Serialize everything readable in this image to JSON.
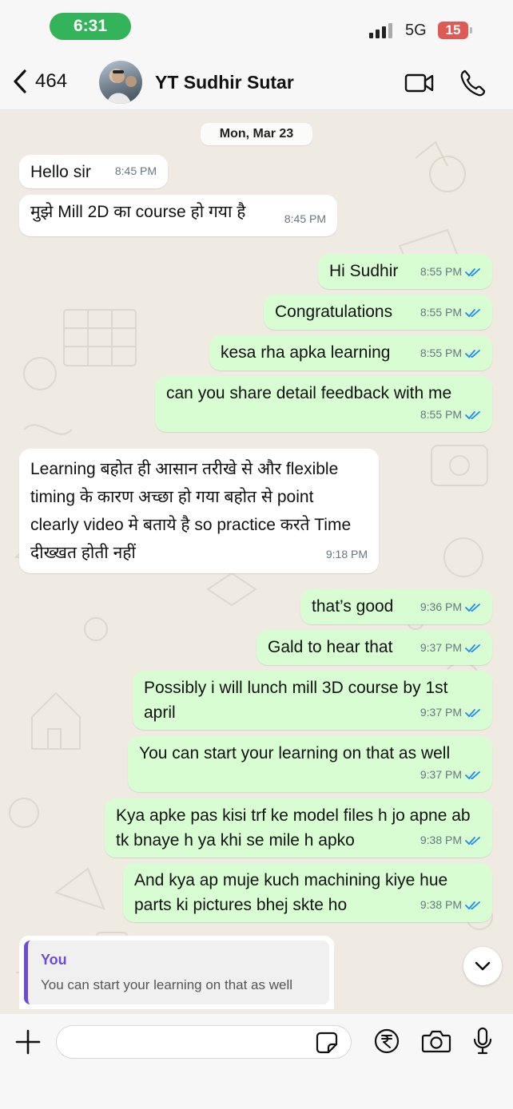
{
  "status_bar": {
    "time": "6:31",
    "network": "5G",
    "battery": "15"
  },
  "header": {
    "back_count": "464",
    "contact_name": "YT Sudhir Sutar"
  },
  "chat": {
    "date": "Mon, Mar 23",
    "messages": [
      {
        "dir": "in",
        "text": "Hello sir",
        "time": "8:45 PM"
      },
      {
        "dir": "in",
        "text": "मुझे Mill 2D का course हो गया है",
        "time": "8:45 PM"
      },
      {
        "dir": "out",
        "text": "Hi Sudhir",
        "time": "8:55 PM"
      },
      {
        "dir": "out",
        "text": "Congratulations",
        "time": "8:55 PM"
      },
      {
        "dir": "out",
        "text": "kesa rha apka learning",
        "time": "8:55 PM"
      },
      {
        "dir": "out",
        "text": "can you share detail feedback with me",
        "time": "8:55 PM"
      },
      {
        "dir": "in",
        "text": "Learning बहोत ही आसान तरीखे से और flexible timing के कारण अच्छा हो गया बहोत से point clearly video मे बताये है so practice करते Time दीख्खत होती नहीं",
        "time": "9:18 PM"
      },
      {
        "dir": "out",
        "text": "that’s good",
        "time": "9:36 PM"
      },
      {
        "dir": "out",
        "text": "Gald to hear that",
        "time": "9:37 PM"
      },
      {
        "dir": "out",
        "text": "Possibly i will lunch mill 3D course by 1st april",
        "time": "9:37 PM"
      },
      {
        "dir": "out",
        "text": "You can start your learning on that as well",
        "time": "9:37 PM"
      },
      {
        "dir": "out",
        "text": "Kya apke pas kisi trf ke model files h jo apne ab tk bnaye h ya khi se mile h apko",
        "time": "9:38 PM"
      },
      {
        "dir": "out",
        "text": "And kya ap muje kuch machining kiye hue parts ki pictures bhej skte ho",
        "time": "9:38 PM"
      }
    ]
  },
  "reply": {
    "author": "You",
    "text": "You can start your learning on that as well"
  },
  "input": {
    "placeholder": ""
  },
  "colors": {
    "outgoing": "#d9fdd3",
    "incoming": "#ffffff",
    "read_ticks": "#1d8cf0",
    "reply_accent": "#6e4bd6"
  },
  "icons": [
    "chevron-left-icon",
    "video-icon",
    "phone-icon",
    "plus-icon",
    "sticker-icon",
    "rupee-icon",
    "camera-icon",
    "mic-icon",
    "chevron-down-icon",
    "double-tick-icon"
  ]
}
